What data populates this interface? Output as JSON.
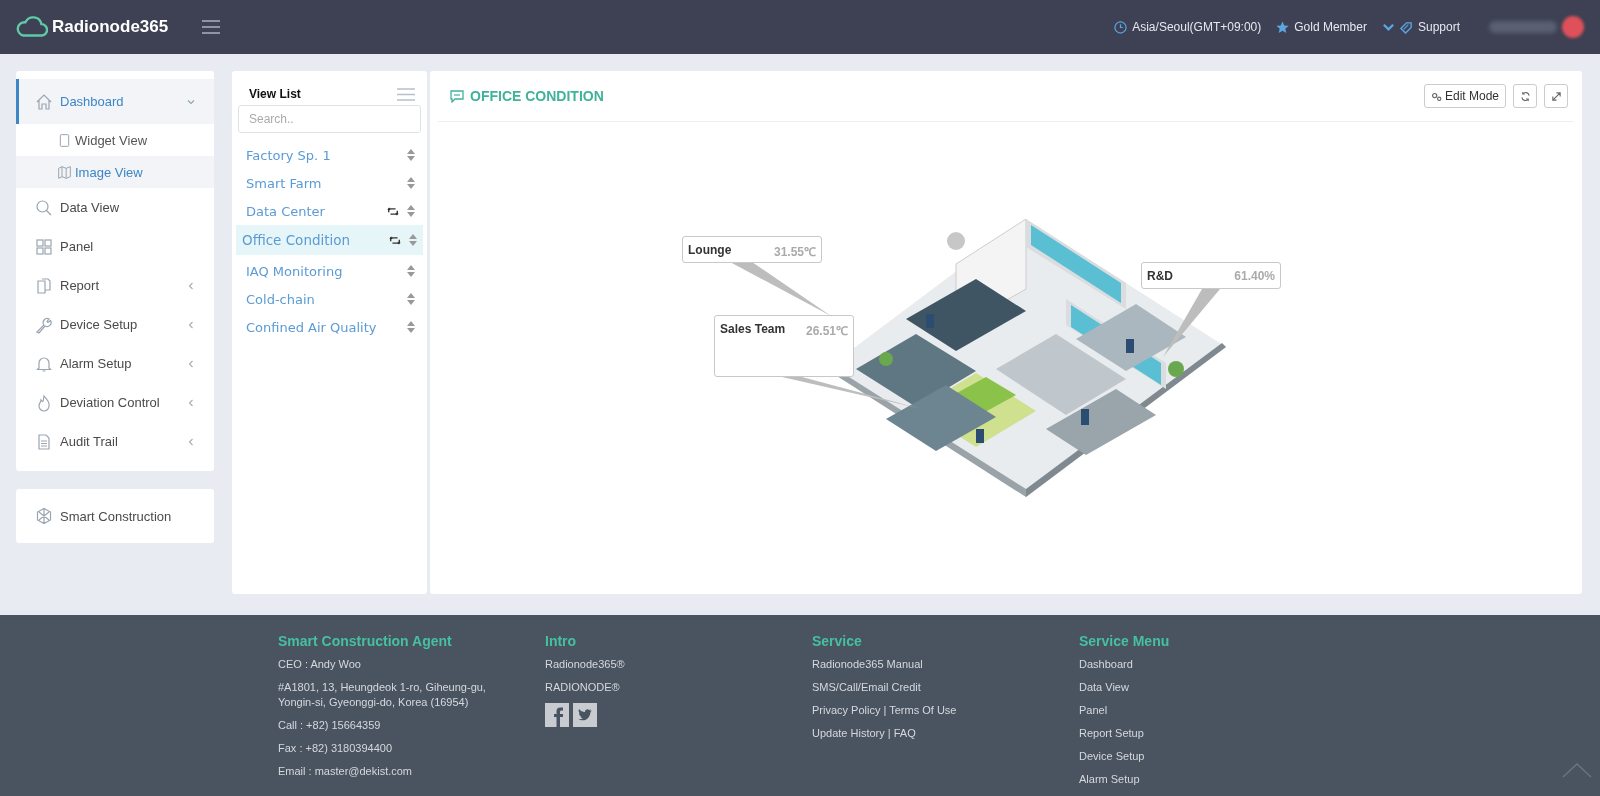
{
  "header": {
    "logo": "Radionode365",
    "timezone": "Asia/Seoul(GMT+09:00)",
    "membership": "Gold Member",
    "support": "Support"
  },
  "sidebar": {
    "items": [
      {
        "label": "Dashboard",
        "selected": true,
        "expanded": true,
        "children": [
          {
            "label": "Widget View",
            "selected": false
          },
          {
            "label": "Image View",
            "selected": true
          }
        ]
      },
      {
        "label": "Data View",
        "selected": false
      },
      {
        "label": "Panel",
        "selected": false
      },
      {
        "label": "Report",
        "selected": false,
        "expanded": false
      },
      {
        "label": "Device Setup",
        "selected": false,
        "expanded": false
      },
      {
        "label": "Alarm Setup",
        "selected": false,
        "expanded": false
      },
      {
        "label": "Deviation Control",
        "selected": false,
        "expanded": false
      },
      {
        "label": "Audit Trail",
        "selected": false,
        "expanded": false
      }
    ],
    "extra": {
      "label": "Smart Construction"
    }
  },
  "view_list": {
    "title": "View List",
    "search": {
      "placeholder": "Search.."
    },
    "items": [
      {
        "label": "Factory Sp. 1",
        "selected": false,
        "rotating": false
      },
      {
        "label": "Smart Farm",
        "selected": false,
        "rotating": false
      },
      {
        "label": "Data Center",
        "selected": false,
        "rotating": true
      },
      {
        "label": "Office Condition",
        "selected": true,
        "rotating": true
      },
      {
        "label": "IAQ Monitoring",
        "selected": false,
        "rotating": false
      },
      {
        "label": "Cold-chain",
        "selected": false,
        "rotating": false
      },
      {
        "label": "Confined Air Quality",
        "selected": false,
        "rotating": false
      }
    ]
  },
  "main": {
    "title": "OFFICE CONDITION",
    "edit_button": "Edit Mode",
    "callouts": [
      {
        "name": "Lounge",
        "value": "31.55℃"
      },
      {
        "name": "Sales Team",
        "value": "26.51℃"
      },
      {
        "name": "R&D",
        "value": "61.40%"
      }
    ]
  },
  "footer": {
    "columns": [
      {
        "title": "Smart Construction Agent",
        "lines": [
          "CEO : Andy Woo",
          "#A1801, 13, Heungdeok 1-ro, Giheung-gu, Yongin-si, Gyeonggi-do, Korea (16954)",
          "Call : +82) 15664359",
          "Fax : +82) 3180394400",
          "Email : master@dekist.com"
        ]
      },
      {
        "title": "Intro",
        "lines": [
          "Radionode365®",
          "RADIONODE®"
        ]
      },
      {
        "title": "Service",
        "lines": [
          "Radionode365 Manual",
          "SMS/Call/Email Credit",
          "Privacy Policy | Terms Of Use",
          "Update History | FAQ"
        ]
      },
      {
        "title": "Service Menu",
        "lines": [
          "Dashboard",
          "Data View",
          "Panel",
          "Report Setup",
          "Device Setup",
          "Alarm Setup"
        ]
      }
    ]
  }
}
